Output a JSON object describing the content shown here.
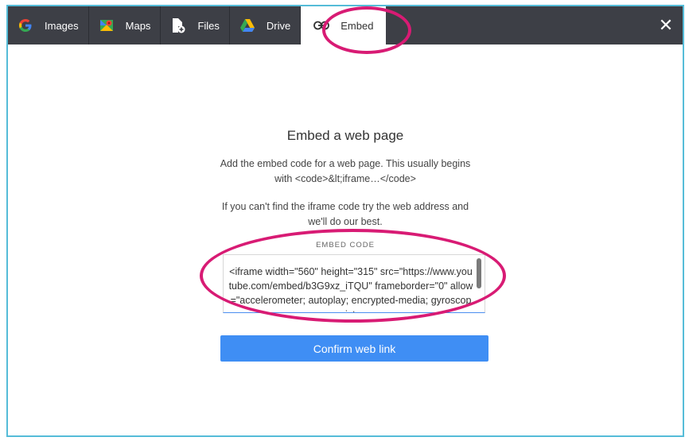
{
  "tabs": [
    {
      "label": "Images",
      "icon": "google-g-icon"
    },
    {
      "label": "Maps",
      "icon": "google-maps-icon"
    },
    {
      "label": "Files",
      "icon": "file-add-icon"
    },
    {
      "label": "Drive",
      "icon": "google-drive-icon"
    },
    {
      "label": "Embed",
      "icon": "link-icon",
      "active": true
    }
  ],
  "close_label": "✕",
  "embed": {
    "title": "Embed a web page",
    "desc1": "Add the embed code for a web page. This usually begins with <code>&lt;iframe…</code>",
    "desc2": "If you can't find the iframe code try the web address and we'll do our best.",
    "field_label": "EMBED CODE",
    "field_value": "<iframe width=\"560\" height=\"315\" src=\"https://www.youtube.com/embed/b3G9xz_iTQU\" frameborder=\"0\" allow=\"accelerometer; autoplay; encrypted-media; gyroscope; picture-",
    "confirm_label": "Confirm web link"
  },
  "colors": {
    "topbar": "#3d3f46",
    "accent": "#3f8ef4",
    "highlight": "#d81b74",
    "frame": "#55bcd8"
  }
}
